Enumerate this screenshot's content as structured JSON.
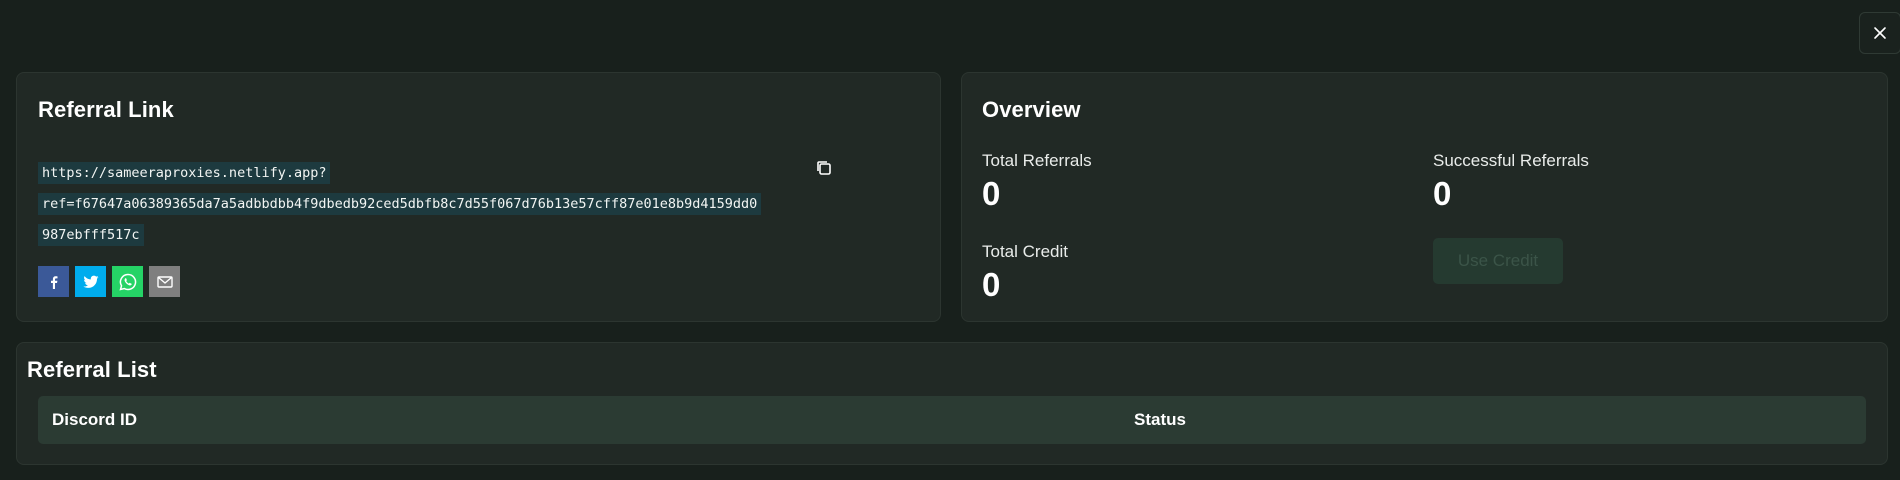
{
  "close": {
    "icon": "close-icon"
  },
  "referral_link": {
    "title": "Referral Link",
    "url_lines": [
      "https://sameeraproxies.netlify.app?",
      "ref=f67647a06389365da7a5adbbdbb4f9dbedb92ced5dbfb8c7d55f067d76b13e57cff87e01e8b9d4159dd0",
      "987ebfff517c"
    ],
    "copy_icon": "copy-icon",
    "share": [
      {
        "name": "facebook",
        "icon": "facebook-icon",
        "color": "#3b5998"
      },
      {
        "name": "twitter",
        "icon": "twitter-icon",
        "color": "#00aced"
      },
      {
        "name": "whatsapp",
        "icon": "whatsapp-icon",
        "color": "#25d366"
      },
      {
        "name": "email",
        "icon": "email-icon",
        "color": "#7f7f7f"
      }
    ]
  },
  "overview": {
    "title": "Overview",
    "total_referrals": {
      "label": "Total Referrals",
      "value": "0"
    },
    "successful_referrals": {
      "label": "Successful Referrals",
      "value": "0"
    },
    "total_credit": {
      "label": "Total Credit",
      "value": "0"
    },
    "use_credit_label": "Use Credit"
  },
  "referral_list": {
    "title": "Referral List",
    "columns": [
      "Discord ID",
      "Status"
    ],
    "rows": []
  },
  "colors": {
    "background": "#18201c",
    "card": "#212925",
    "table_header": "#2b3b33",
    "link_highlight": "#1d3a3f"
  }
}
